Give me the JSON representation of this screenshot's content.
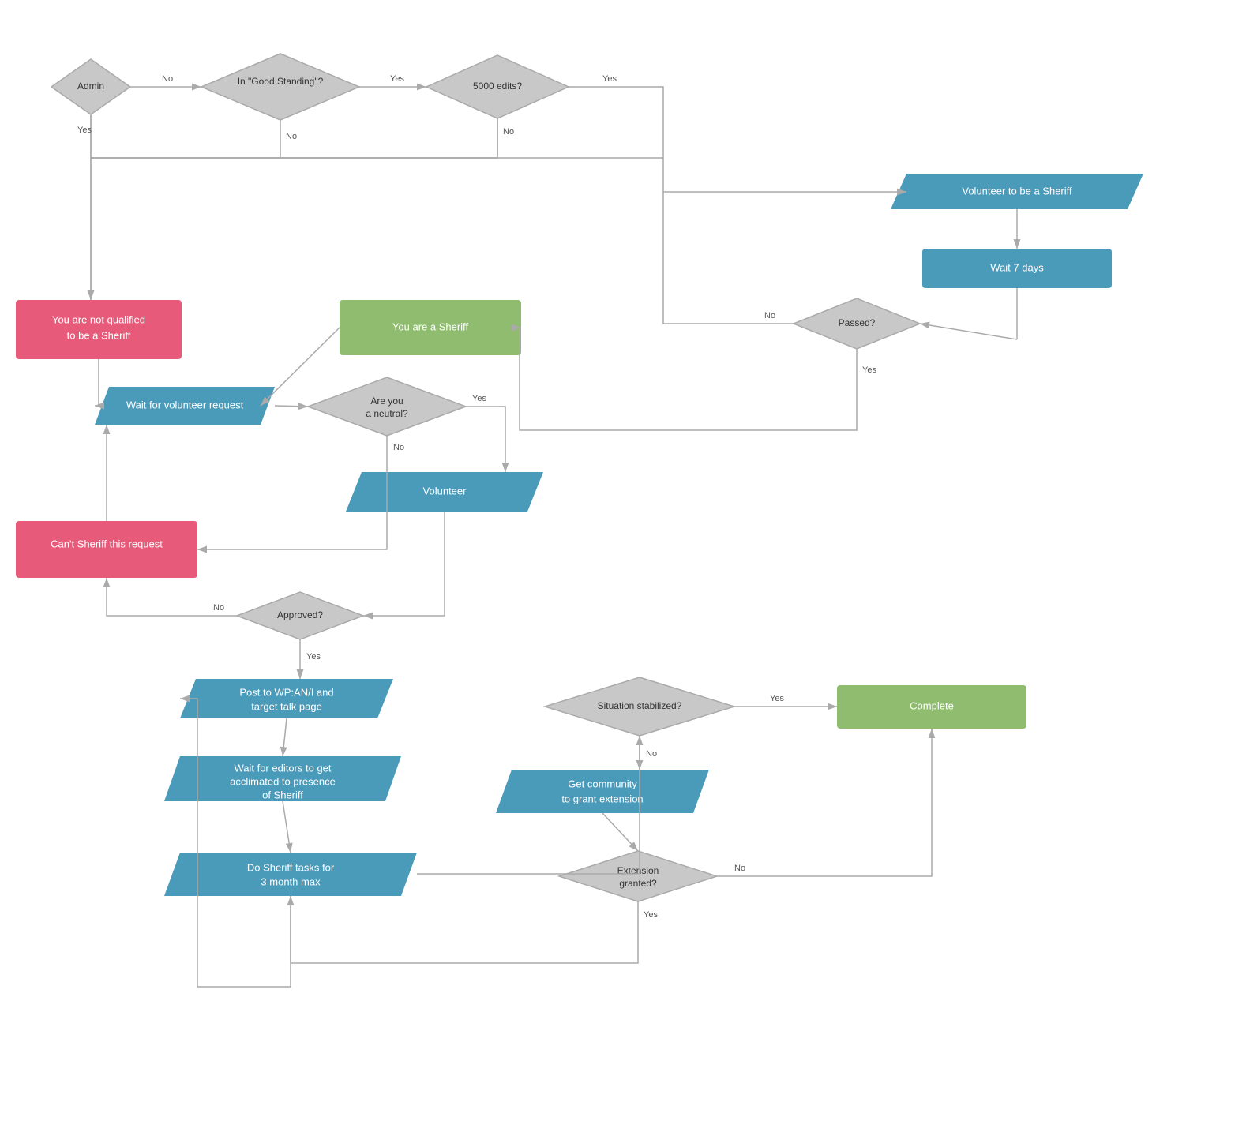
{
  "nodes": {
    "admin": {
      "label": "Admin"
    },
    "good_standing": {
      "label": "In \"Good Standing\"?"
    },
    "edits_5000": {
      "label": "5000 edits?"
    },
    "volunteer_sheriff": {
      "label": "Volunteer to be a Sheriff"
    },
    "wait_7_days": {
      "label": "Wait 7 days"
    },
    "passed": {
      "label": "Passed?"
    },
    "not_qualified": {
      "label": "You are not qualified\nto be a Sheriff"
    },
    "you_are_sheriff": {
      "label": "You are a Sheriff"
    },
    "wait_volunteer": {
      "label": "Wait for volunteer request"
    },
    "are_you_neutral": {
      "label": "Are you\na neutral?"
    },
    "volunteer": {
      "label": "Volunteer"
    },
    "cant_sheriff": {
      "label": "Can't Sheriff this request"
    },
    "approved": {
      "label": "Approved?"
    },
    "post_wp": {
      "label": "Post to WP:AN/I and\ntarget talk page"
    },
    "wait_editors": {
      "label": "Wait for editors to get\nacclimated to presence\nof Sheriff"
    },
    "do_tasks": {
      "label": "Do Sheriff tasks for\n3 month max"
    },
    "situation_stabilized": {
      "label": "Situation stabilized?"
    },
    "complete": {
      "label": "Complete"
    },
    "get_community": {
      "label": "Get community\nto grant extension"
    },
    "extension_granted": {
      "label": "Extension\ngranted?"
    }
  },
  "edge_labels": {
    "admin_no": "No",
    "admin_yes": "Yes",
    "good_no": "No",
    "good_yes": "Yes",
    "edits_yes": "Yes",
    "edits_no": "No",
    "passed_no": "No",
    "passed_yes": "Yes",
    "neutral_yes": "Yes",
    "neutral_no": "No",
    "approved_no": "No",
    "approved_yes": "Yes",
    "situation_yes": "Yes",
    "situation_no": "No",
    "extension_no": "No",
    "extension_yes": "Yes"
  }
}
